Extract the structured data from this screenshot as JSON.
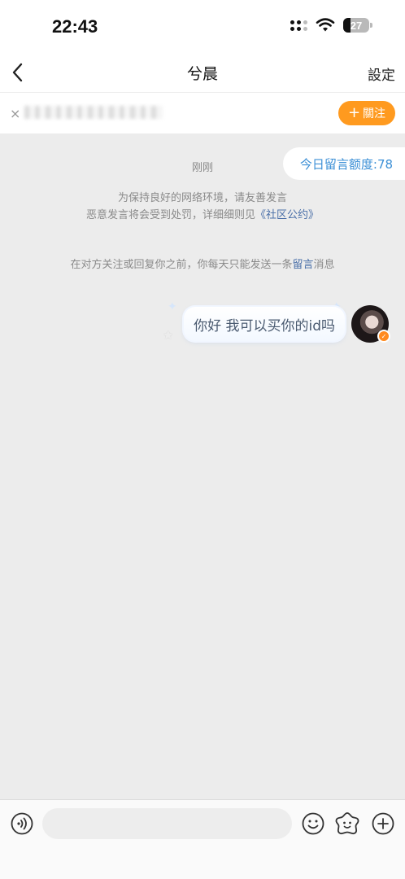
{
  "status_bar": {
    "time": "22:43",
    "battery": "27"
  },
  "header": {
    "title": "兮晨",
    "settings_label": "設定"
  },
  "tip_bar": {
    "follow_label": "關注",
    "close_symbol": "×"
  },
  "chat": {
    "quota_label": "今日留言额度:78",
    "time_label": "刚刚",
    "notice_line1": "为保持良好的网络环境，请友善发言",
    "notice_line2_prefix": "恶意发言将会受到处罚，详细细则见",
    "notice_link": "《社区公约》",
    "limit_prefix": "在对方关注或回复你之前，你每天只能发送一条",
    "limit_highlight": "留言",
    "limit_suffix": "消息",
    "message_text": "你好 我可以买你的id吗"
  },
  "input_bar": {
    "placeholder": ""
  },
  "icons": {
    "back": "chevron-left-icon",
    "voice": "voice-icon",
    "emoji": "emoji-icon",
    "sticker": "sticker-icon",
    "plus": "plus-circle-icon"
  },
  "colors": {
    "accent": "#ff9a1f",
    "link": "#4a6fa8",
    "quota": "#3b8fd6"
  }
}
